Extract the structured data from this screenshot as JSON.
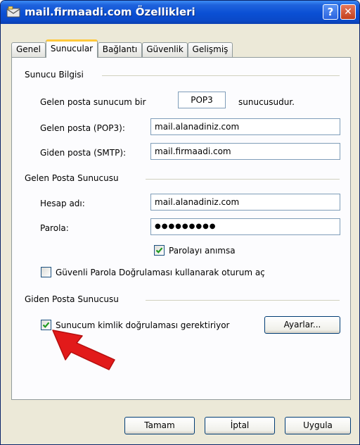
{
  "window": {
    "title": "mail.firmaadi.com Özellikleri",
    "help_glyph": "?",
    "close_glyph": "✕"
  },
  "tabs": [
    {
      "label": "Genel",
      "active": false
    },
    {
      "label": "Sunucular",
      "active": true
    },
    {
      "label": "Bağlantı",
      "active": false
    },
    {
      "label": "Güvenlik",
      "active": false
    },
    {
      "label": "Gelişmiş",
      "active": false
    }
  ],
  "server_info": {
    "group_label": "Sunucu Bilgisi",
    "incoming_type_prefix": "Gelen posta sunucum bir",
    "incoming_type_value": "POP3",
    "incoming_type_suffix": "sunucusudur.",
    "pop3_label": "Gelen posta (POP3):",
    "pop3_value": "mail.alanadiniz.com",
    "smtp_label": "Giden posta (SMTP):",
    "smtp_value": "mail.firmaadi.com"
  },
  "incoming": {
    "group_label": "Gelen Posta Sunucusu",
    "account_label": "Hesap adı:",
    "account_value": "mail.alanadiniz.com",
    "password_label": "Parola:",
    "password_value": "●●●●●●●●●",
    "remember_password_label": "Parolayı anımsa",
    "remember_password_checked": true,
    "spa_label": "Güvenli Parola Doğrulaması kullanarak oturum aç",
    "spa_checked": false
  },
  "outgoing": {
    "group_label": "Giden Posta Sunucusu",
    "auth_required_label": "Sunucum kimlik doğrulaması gerektiriyor",
    "auth_required_checked": true,
    "settings_button": "Ayarlar..."
  },
  "buttons": {
    "ok": "Tamam",
    "cancel": "İptal",
    "apply": "Uygula"
  },
  "colors": {
    "titlebar": "#0a4fd4",
    "annotation_arrow": "#e21a1a",
    "checkmark": "#21a121"
  }
}
